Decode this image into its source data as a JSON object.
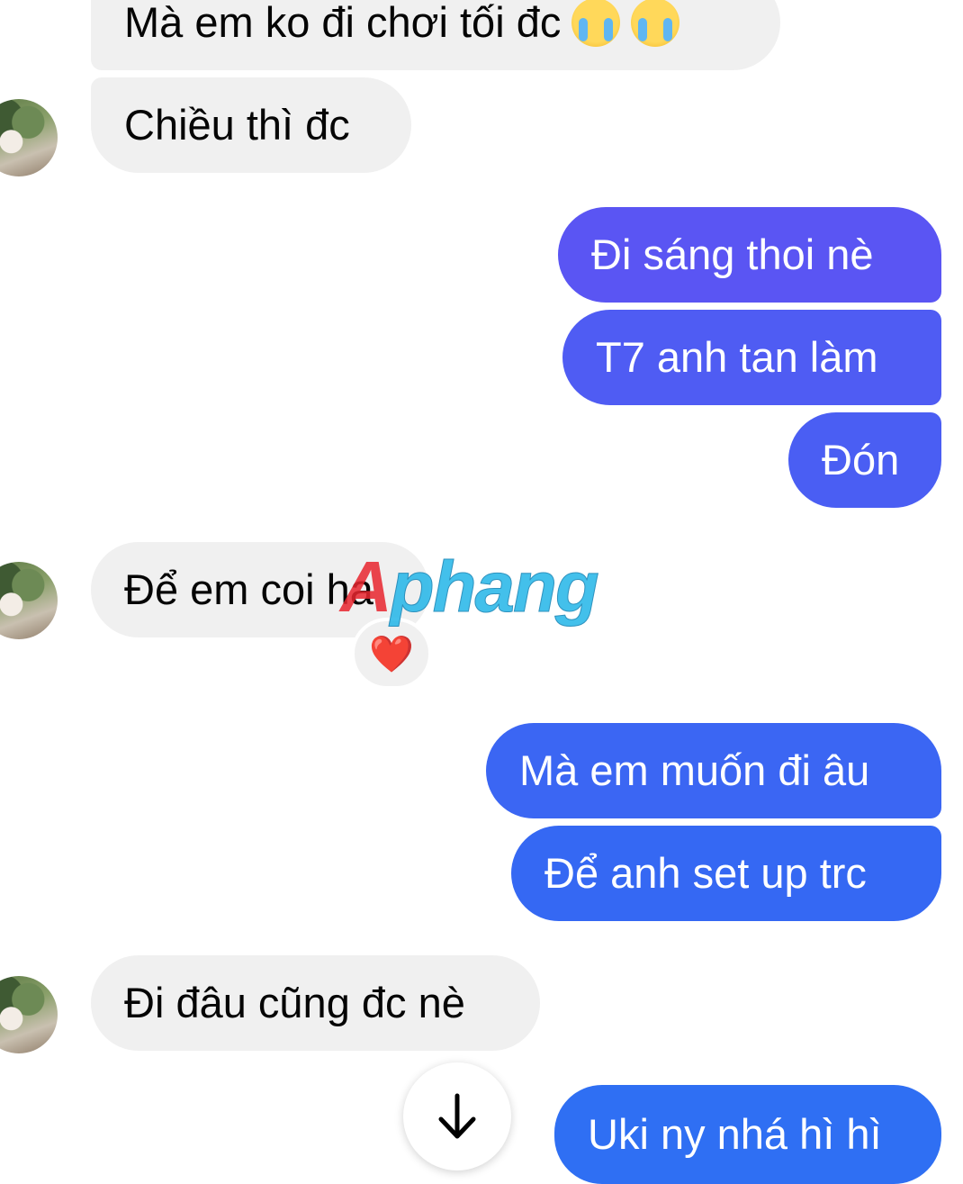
{
  "messages": {
    "m1": "Mà em ko đi chơi tối đc",
    "m2": "Chiều thì đc",
    "m3": "Đi sáng thoi nè",
    "m4": "T7 anh tan làm",
    "m5": "Đón",
    "m6": "Để em coi ha",
    "m7": "Mà em muốn đi âu",
    "m8": "Để anh set up trc",
    "m9": "Đi đâu cũng đc nè",
    "m10": "Uki ny nhá hì hì"
  },
  "reaction": {
    "emoji": "❤️"
  },
  "emojis": {
    "crying": "loudly-crying-face"
  },
  "watermark": {
    "first": "A",
    "rest": "phang"
  },
  "colors": {
    "incoming_bg": "#f0f0f0",
    "outgoing_violet": "#5a55f3",
    "outgoing_blue": "#2f6ff3",
    "reaction_heart": "#e0102a"
  }
}
